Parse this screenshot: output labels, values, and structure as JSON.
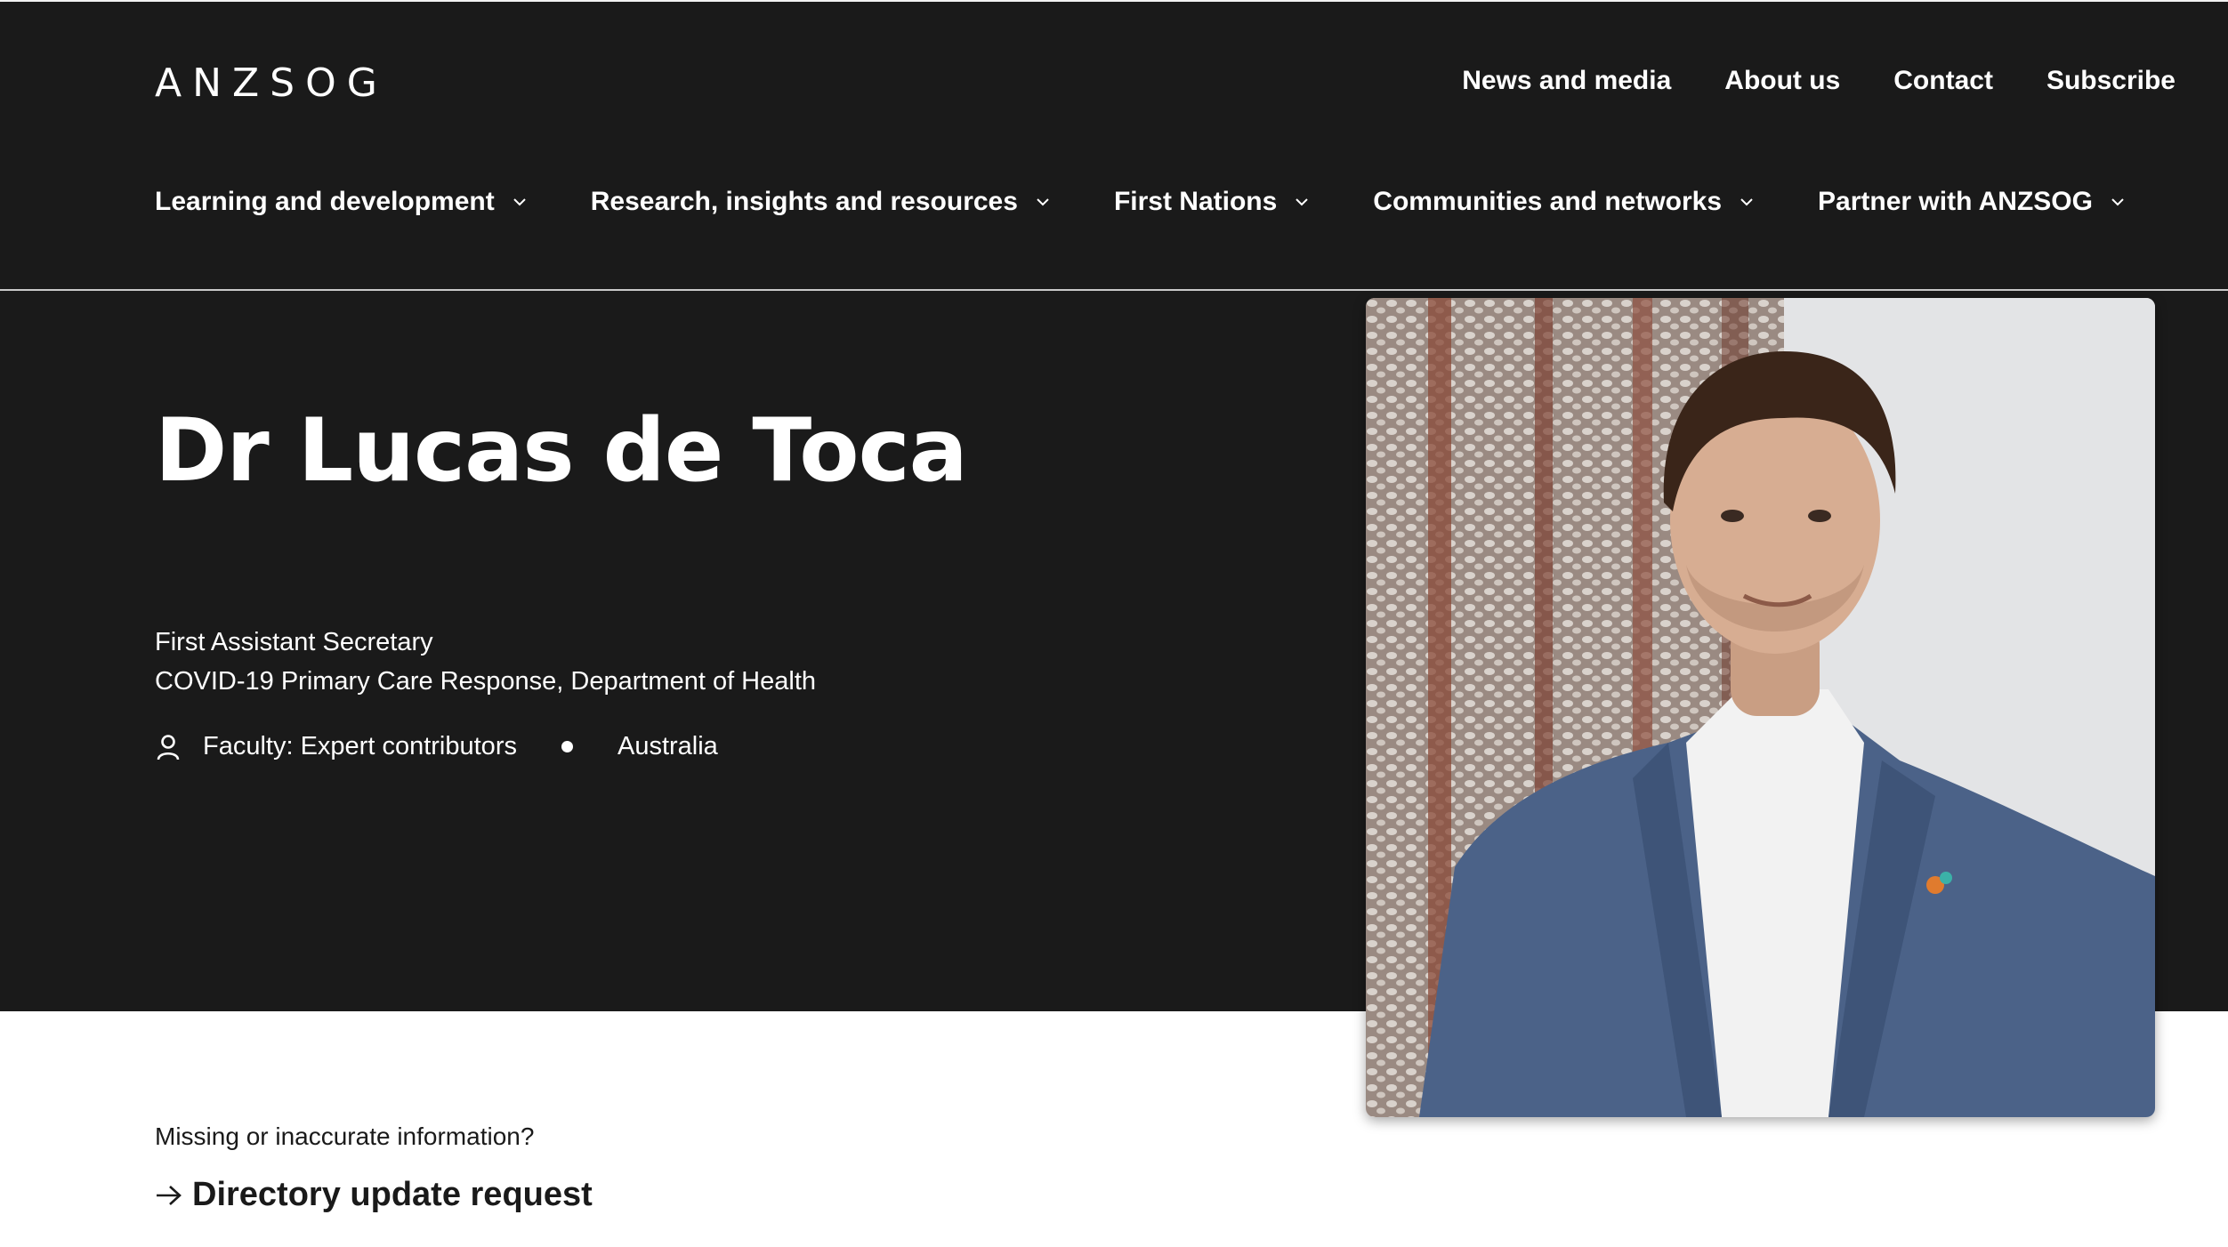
{
  "header": {
    "logo": "ANZSOG",
    "utility_links": [
      "News and media",
      "About us",
      "Contact",
      "Subscribe"
    ],
    "main_nav": [
      "Learning and development",
      "Research, insights and resources",
      "First Nations",
      "Communities and networks",
      "Partner with ANZSOG"
    ]
  },
  "profile": {
    "name": "Dr Lucas de Toca",
    "position": "First Assistant Secretary",
    "organisation": "COVID-19 Primary Care Response, Department of Health",
    "faculty": "Faculty: Expert contributors",
    "country": "Australia"
  },
  "footer": {
    "missing_text": "Missing or inaccurate information?",
    "update_link": "Directory update request"
  },
  "colors": {
    "background_dark": "#1a1a1a",
    "text_light": "#ffffff",
    "text_dark": "#1a1a1a"
  },
  "icons": {
    "chevron": "chevron-down-icon",
    "person": "person-icon",
    "arrow": "arrow-right-icon"
  }
}
